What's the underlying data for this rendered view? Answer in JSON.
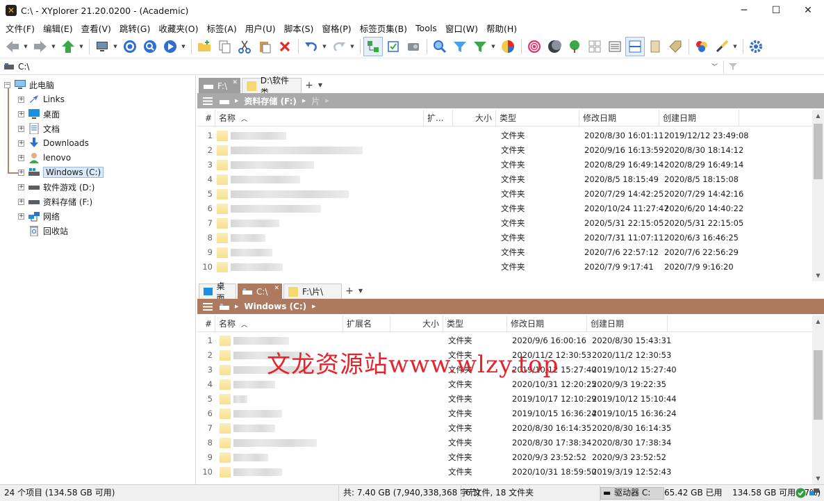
{
  "window": {
    "title": "C:\\ - XYplorer 21.20.0200 - (Academic)",
    "app_icon_glyph": "✕",
    "buttons": {
      "minimize": "─",
      "maximize": "☐",
      "close": "✕"
    }
  },
  "menu": [
    "文件(F)",
    "编辑(E)",
    "查看(V)",
    "跳转(G)",
    "收藏夹(O)",
    "标签(A)",
    "用户(U)",
    "脚本(S)",
    "窗格(P)",
    "标签页集(B)",
    "Tools",
    "窗口(W)",
    "帮助(H)"
  ],
  "address": {
    "path": "C:\\"
  },
  "tree": {
    "items": [
      {
        "label": "此电脑",
        "icon": "computer-icon"
      },
      {
        "label": "Links",
        "icon": "links-icon"
      },
      {
        "label": "桌面",
        "icon": "desktop-icon"
      },
      {
        "label": "文档",
        "icon": "documents-icon"
      },
      {
        "label": "Downloads",
        "icon": "downloads-icon"
      },
      {
        "label": "lenovo",
        "icon": "user-icon"
      },
      {
        "label": "Windows (C:)",
        "icon": "drive-c-icon"
      },
      {
        "label": "软件游戏 (D:)",
        "icon": "drive-icon"
      },
      {
        "label": "资料存储 (F:)",
        "icon": "drive-icon"
      },
      {
        "label": "网络",
        "icon": "network-icon"
      },
      {
        "label": "回收站",
        "icon": "recycle-bin-icon"
      }
    ]
  },
  "pane1": {
    "tabs": [
      {
        "label": "F:\\",
        "icon": "drive-icon"
      },
      {
        "label": "D:\\软件类",
        "icon": "folder-icon"
      }
    ],
    "tab_add": "+",
    "breadcrumb": [
      "资料存储 (F:)",
      "片"
    ],
    "columns": {
      "num": "#",
      "name": "名称",
      "ext": "扩...",
      "size": "大小",
      "type": "类型",
      "modified": "修改日期",
      "created": "创建日期"
    },
    "rows": [
      {
        "n": "1",
        "type": "文件夹",
        "modified": "2020/8/30 16:01:11",
        "created": "2019/12/12 23:49:08"
      },
      {
        "n": "2",
        "type": "文件夹",
        "modified": "2020/9/16 16:13:59",
        "created": "2020/8/30 18:14:12"
      },
      {
        "n": "3",
        "type": "文件夹",
        "modified": "2020/8/29 16:49:14",
        "created": "2020/8/29 16:49:14"
      },
      {
        "n": "4",
        "type": "文件夹",
        "modified": "2020/8/5 18:15:49",
        "created": "2020/8/5 18:15:08"
      },
      {
        "n": "5",
        "type": "文件夹",
        "modified": "2020/7/29 14:42:25",
        "created": "2020/7/29 14:42:16"
      },
      {
        "n": "6",
        "type": "文件夹",
        "modified": "2020/10/24 11:27:47",
        "created": "2020/6/20 14:40:22"
      },
      {
        "n": "7",
        "type": "文件夹",
        "modified": "2020/5/31 22:15:05",
        "created": "2020/5/31 22:15:05"
      },
      {
        "n": "8",
        "type": "文件夹",
        "modified": "2020/7/31 11:07:11",
        "created": "2020/6/3 16:46:25"
      },
      {
        "n": "9",
        "type": "文件夹",
        "modified": "2020/7/6 22:57:12",
        "created": "2020/7/6 22:56:29"
      },
      {
        "n": "10",
        "type": "文件夹",
        "modified": "2020/7/9 9:17:41",
        "created": "2020/7/9 9:16:20"
      }
    ]
  },
  "pane2": {
    "tabs": [
      {
        "label": "桌面",
        "icon": "desktop-icon"
      },
      {
        "label": "C:\\",
        "icon": "drive-c-icon"
      },
      {
        "label": "F:\\片\\",
        "icon": "folder-icon"
      }
    ],
    "tab_add": "+",
    "breadcrumb": [
      "Windows (C:)"
    ],
    "columns": {
      "num": "#",
      "name": "名称",
      "ext": "扩展名",
      "size": "大小",
      "type": "类型",
      "modified": "修改日期",
      "created": "创建日期"
    },
    "rows": [
      {
        "n": "1",
        "type": "文件夹",
        "modified": "2020/9/6 16:00:16",
        "created": "2020/8/30 15:43:31"
      },
      {
        "n": "2",
        "type": "文件夹",
        "modified": "2020/11/2 12:30:53",
        "created": "2020/11/2 12:30:53"
      },
      {
        "n": "3",
        "type": "文件夹",
        "modified": "2019/10/12 15:27:40",
        "created": "2019/10/12 15:27:40"
      },
      {
        "n": "4",
        "type": "文件夹",
        "modified": "2020/10/31 12:20:25",
        "created": "2020/9/3 19:22:35"
      },
      {
        "n": "5",
        "type": "文件夹",
        "modified": "2019/10/17 12:10:29",
        "created": "2019/10/12 15:10:44"
      },
      {
        "n": "6",
        "type": "文件夹",
        "modified": "2019/10/15 16:36:24",
        "created": "2019/10/15 16:36:24"
      },
      {
        "n": "7",
        "type": "文件夹",
        "modified": "2020/8/30 16:14:35",
        "created": "2020/8/30 16:14:35"
      },
      {
        "n": "8",
        "type": "文件夹",
        "modified": "2020/8/30 17:38:34",
        "created": "2020/8/30 17:38:34"
      },
      {
        "n": "9",
        "type": "文件夹",
        "modified": "2020/9/3 23:52:52",
        "created": "2020/9/3 23:52:52"
      },
      {
        "n": "10",
        "type": "文件夹",
        "modified": "2020/10/31 18:59:50",
        "created": "2019/3/19 12:52:43"
      }
    ]
  },
  "watermark": "文龙资源站www.wlzy.top",
  "status": {
    "items": "24 个项目 (134.58 GB 可用)",
    "total": "共: 7.40 GB (7,940,338,368 字节)",
    "counts": "6 文件, 18 文件夹",
    "drive": "驱动器 C:",
    "used": "65.42 GB 已用",
    "free": "134.58 GB 可用(67%)",
    "free_fraction": 0.67
  },
  "colors": {
    "accent_brown": "#ad7a5f",
    "pane_grey": "#a9a9a9",
    "selection": "#dbe8f8",
    "ok_green": "#2e9e3c"
  }
}
